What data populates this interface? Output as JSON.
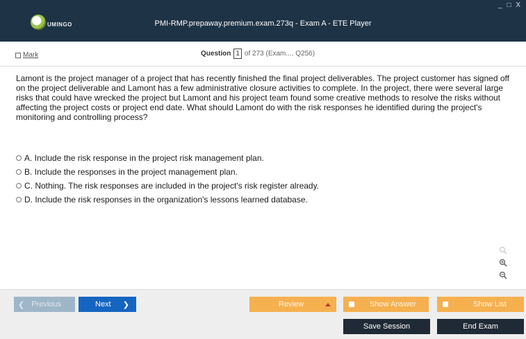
{
  "window": {
    "title": "PMI-RMP.prepaway.premium.exam.273q - Exam A - ETE Player",
    "logo_text": "UMINGO",
    "controls": "_ □ X"
  },
  "infobar": {
    "mark_label": "Mark",
    "question_label": "Question",
    "question_number": "1",
    "question_rest": "of 273 (Exam..., Q256)"
  },
  "question": {
    "text": "Lamont is the project manager of a project that has recently finished the final project deliverables. The project customer has signed off on the project deliverable and Lamont has a few administrative closure activities to complete. In the project, there were several large risks that could have wrecked the project but Lamont and his project team found some creative methods to resolve the risks without affecting the project costs or project end date. What should Lamont do with the risk responses he identified during the project's monitoring and controlling process?",
    "options": [
      "A. Include the risk response in the project risk management plan.",
      "B. Include the responses in the project management plan.",
      "C. Nothing. The risk responses are included in the project's risk register already.",
      "D. Include the risk responses in the organization's lessons learned database."
    ]
  },
  "zoom_tools": {
    "search_icon": "search-icon",
    "zoom_in_icon": "zoom-in-icon",
    "zoom_out_icon": "zoom-out-icon"
  },
  "nav": {
    "previous_label": "Previous",
    "next_label": "Next",
    "review_label": "Review",
    "show_answer_label": "Show Answer",
    "show_list_label": "Show List",
    "save_session_label": "Save Session",
    "end_exam_label": "End Exam"
  },
  "colors": {
    "titlebar": "#1f3346",
    "next_button": "#1565c0",
    "orange_buttons": "#f5b04f",
    "dark_buttons": "#1f2a36"
  }
}
